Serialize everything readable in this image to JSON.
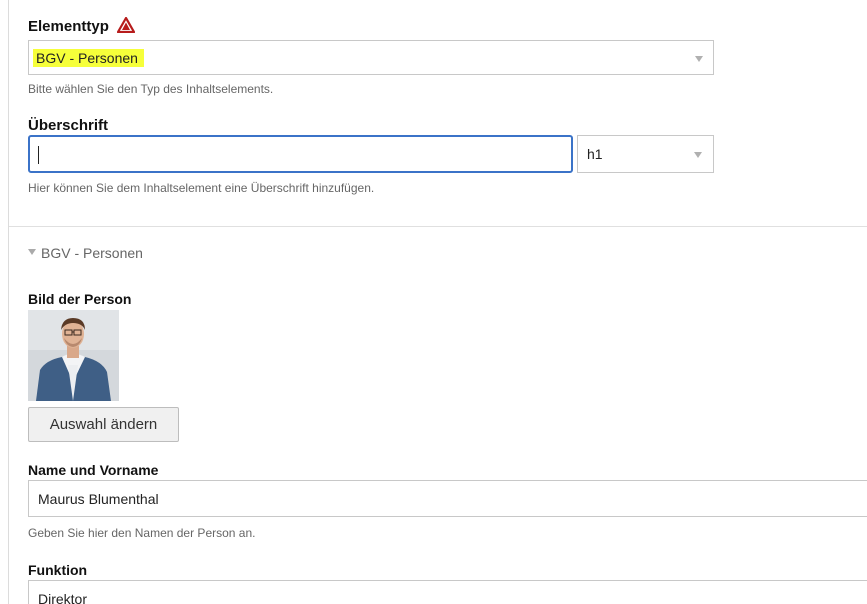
{
  "element_type": {
    "label": "Elementtyp",
    "warning_icon": "warning-triangle-icon",
    "selected_value": "BGV - Personen",
    "help": "Bitte wählen Sie den Typ des Inhaltselements."
  },
  "heading": {
    "label": "Überschrift",
    "value": "",
    "level_selected": "h1",
    "help": "Hier können Sie dem Inhaltselement eine Überschrift hinzufügen."
  },
  "section": {
    "title": "BGV - Personen",
    "toggle_icon": "triangle-down-icon"
  },
  "person_image": {
    "label": "Bild der Person",
    "change_button": "Auswahl ändern"
  },
  "name": {
    "label": "Name und Vorname",
    "value": "Maurus Blumenthal",
    "help": "Geben Sie hier den Namen der Person an."
  },
  "function": {
    "label": "Funktion",
    "value": "Direktor"
  },
  "colors": {
    "highlight": "#f6ff3a",
    "focus_border": "#3b73c8",
    "warning_red": "#b71c1c"
  }
}
